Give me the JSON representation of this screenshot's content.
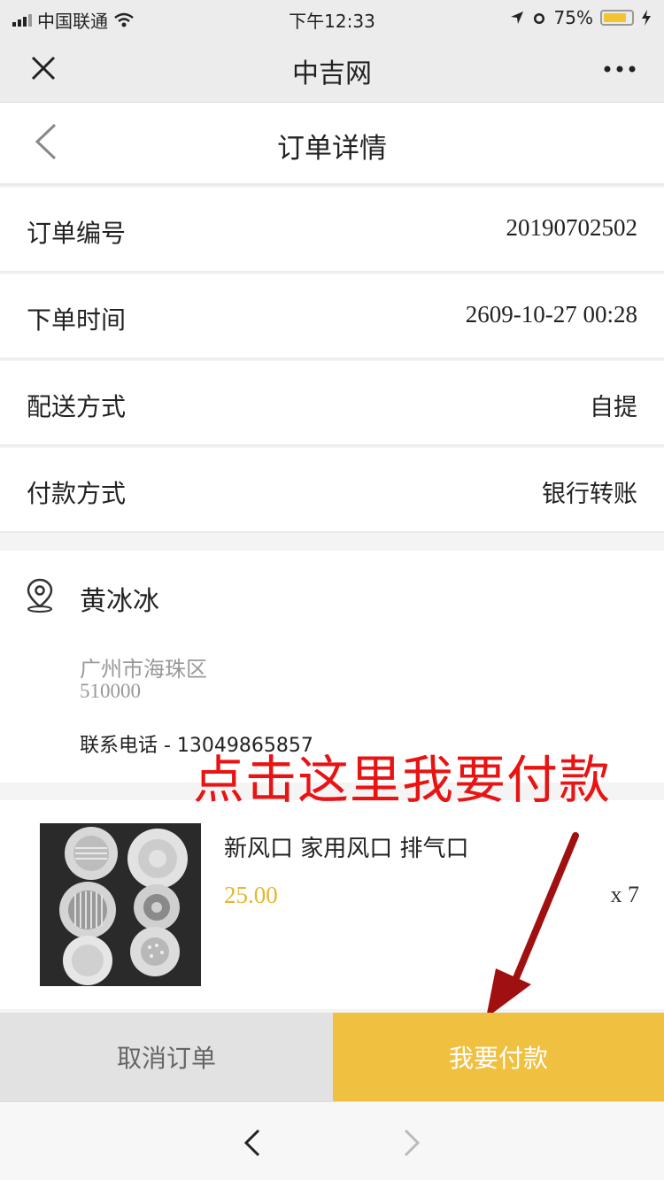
{
  "status_bar": {
    "carrier": "中国联通",
    "time": "下午12:33",
    "battery": "75%"
  },
  "wechat_bar": {
    "close_icon": "close-icon",
    "title": "中吉网",
    "more_icon": "more-icon"
  },
  "header": {
    "back_icon": "chevron-left-icon",
    "title": "订单详情"
  },
  "order_info": {
    "rows": [
      {
        "label": "订单编号",
        "value": "20190702502"
      },
      {
        "label": "下单时间",
        "value": "2609-10-27 00:28"
      },
      {
        "label": "配送方式",
        "value": "自提"
      },
      {
        "label": "付款方式",
        "value": "银行转账"
      }
    ]
  },
  "address": {
    "icon": "location-pin-icon",
    "name": "黄冰冰",
    "line1": "广州市海珠区",
    "line2": "510000",
    "phone": "联系电话 - 13049865857"
  },
  "annotation": {
    "text": "点击这里我要付款",
    "color": "#e81414"
  },
  "product": {
    "name": "新风口 家用风口 排气口",
    "price": "25.00",
    "quantity": "x 7"
  },
  "actions": {
    "cancel_label": "取消订单",
    "pay_label": "我要付款"
  },
  "colors": {
    "accent": "#f0c040",
    "price": "#e6b62e"
  }
}
